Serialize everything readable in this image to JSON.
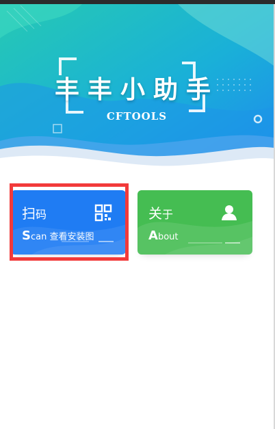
{
  "hero": {
    "title": "丰丰小助手",
    "subtitle": "CFTOOLS"
  },
  "cards": {
    "scan": {
      "title_main": "扫",
      "title_small": "码",
      "sub_big": "S",
      "sub_rest": "can 查看安装图",
      "icon": "qr-code-icon",
      "color": "#1f7cf3"
    },
    "about": {
      "title_main": "关",
      "title_small": "于",
      "sub_big": "A",
      "sub_rest": "bout",
      "icon": "user-icon",
      "color": "#45bd52"
    }
  },
  "highlight_color": "#f23a3a"
}
